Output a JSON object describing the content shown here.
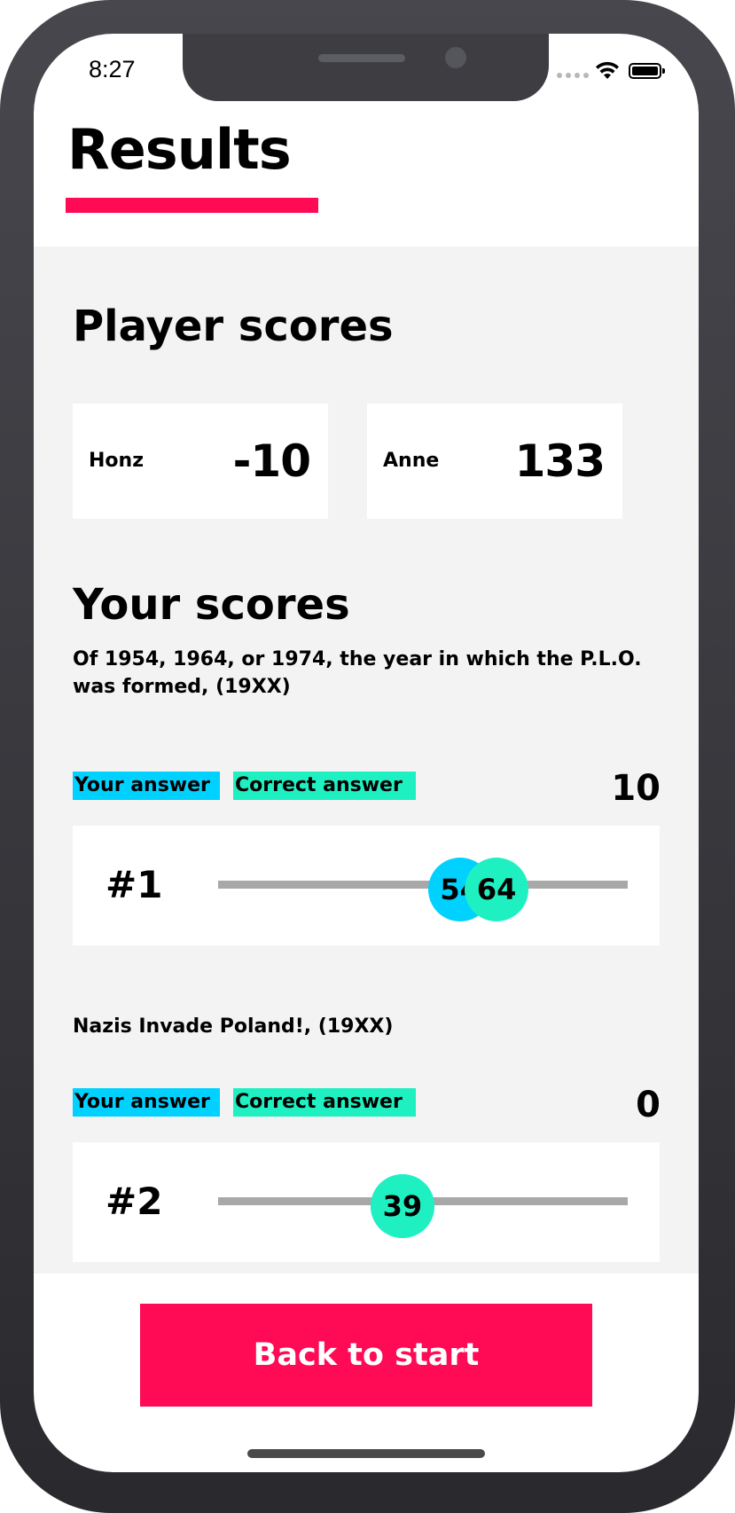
{
  "status_bar": {
    "time": "8:27"
  },
  "header": {
    "title": "Results",
    "accent_color": "#fe0a55"
  },
  "player_scores": {
    "heading": "Player scores",
    "players": [
      {
        "name": "Honz",
        "score": "-10"
      },
      {
        "name": "Anne",
        "score": "133"
      }
    ]
  },
  "your_scores": {
    "heading": "Your scores",
    "legend": {
      "your_answer": "Your answer",
      "correct_answer": "Correct answer",
      "your_answer_color": "#00d1ff",
      "correct_answer_color": "#1ff0c2"
    },
    "questions": [
      {
        "text": "Of 1954, 1964, or 1974, the year in which the P.L.O. was formed, (19XX)",
        "points": "10",
        "number": "#1",
        "your_answer": "54",
        "correct_answer": "64",
        "your_answer_position": 0.59,
        "correct_answer_position": 0.68
      },
      {
        "text": "Nazis Invade Poland!, (19XX)",
        "points": "0",
        "number": "#2",
        "your_answer": "39",
        "correct_answer": "39",
        "your_answer_position": 0.45,
        "correct_answer_position": 0.45
      }
    ]
  },
  "footer": {
    "back_button": "Back to start"
  }
}
